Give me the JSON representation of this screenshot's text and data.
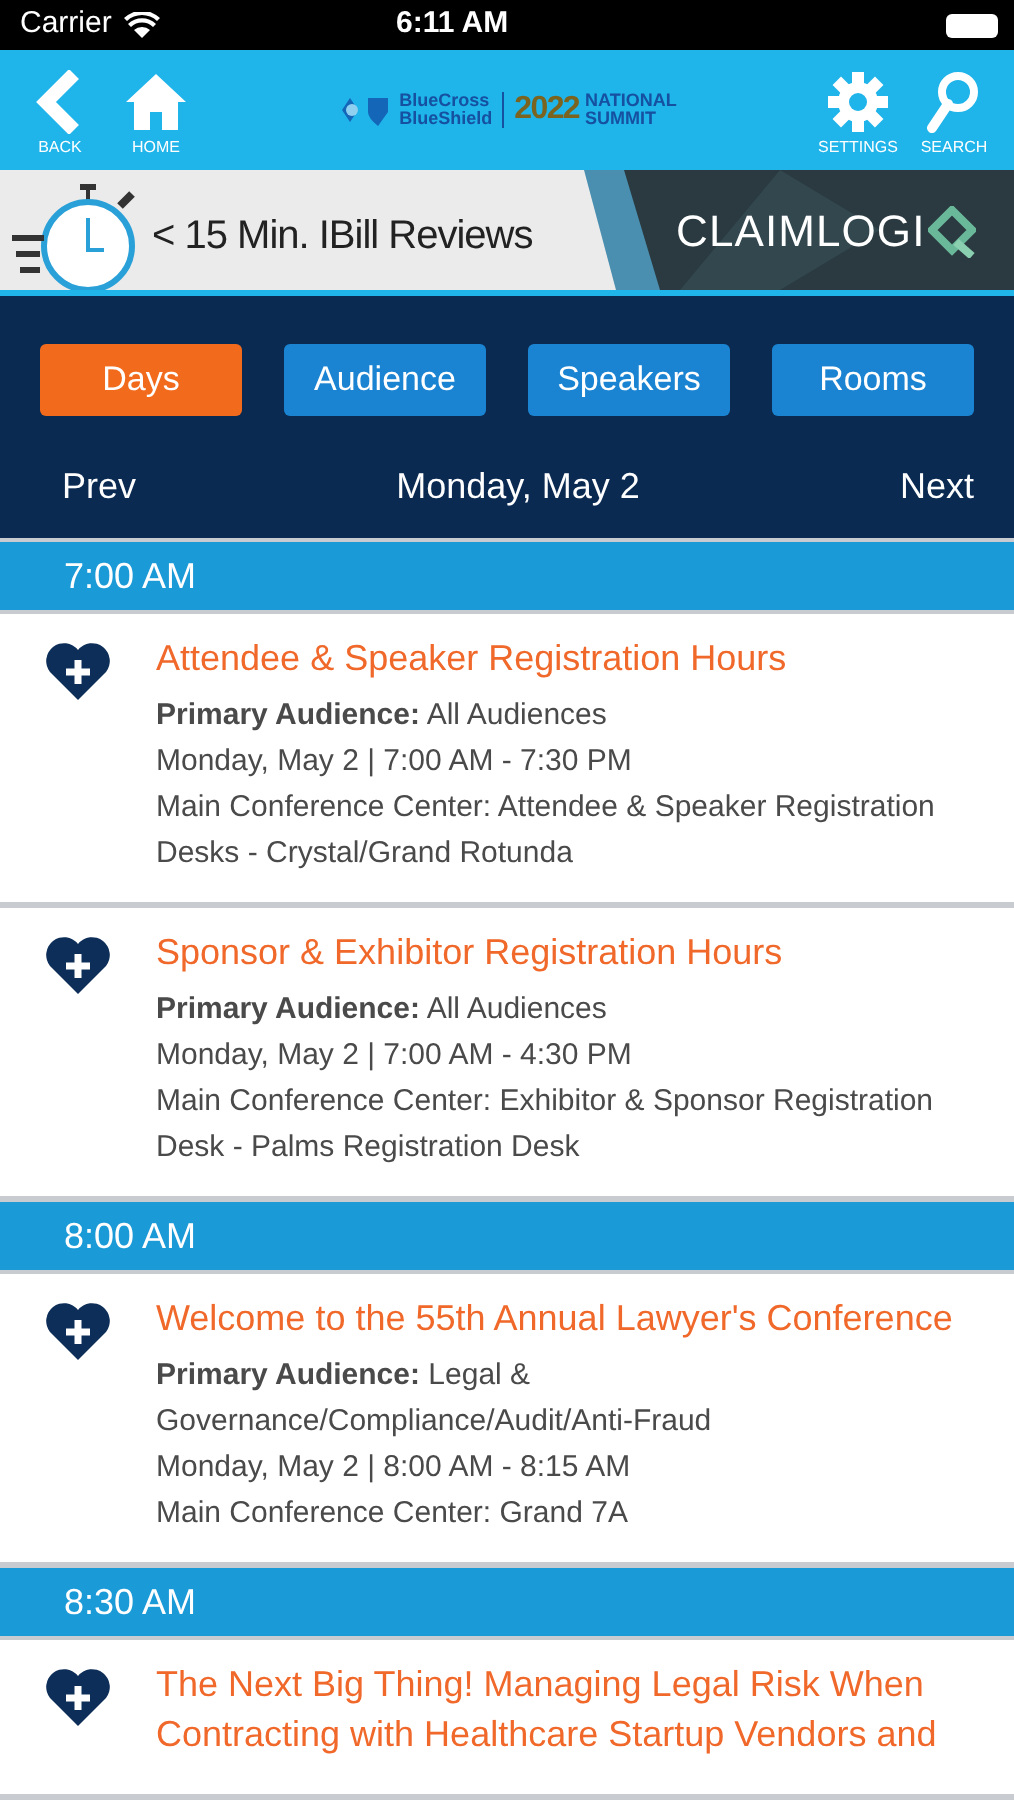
{
  "status_bar": {
    "carrier": "Carrier",
    "time": "6:11 AM"
  },
  "nav_bar": {
    "left": [
      {
        "kind": "back",
        "label": "BACK"
      },
      {
        "kind": "home",
        "label": "HOME"
      }
    ],
    "logo": {
      "brand_line_1": "BlueCross",
      "brand_line_2": "BlueShield",
      "year": "2022",
      "event_line_1": "NATIONAL",
      "event_line_2": "SUMMIT"
    },
    "right": [
      {
        "kind": "settings",
        "label": "SETTINGS"
      },
      {
        "kind": "search",
        "label": "SEARCH"
      }
    ]
  },
  "banner": {
    "headline": "< 15 Min. IBill Reviews",
    "brand": "CLAIMLOGI"
  },
  "tabs": [
    {
      "label": "Days",
      "selected": true
    },
    {
      "label": "Audience",
      "selected": false
    },
    {
      "label": "Speakers",
      "selected": false
    },
    {
      "label": "Rooms",
      "selected": false
    }
  ],
  "day_nav": {
    "prev": "Prev",
    "day": "Monday, May 2",
    "next": "Next"
  },
  "schedule": [
    {
      "time": "7:00 AM",
      "sessions": [
        {
          "title": "Attendee & Speaker Registration Hours",
          "audience": "**Primary Audience:** All Audiences",
          "when": "Monday, May 2 | 7:00 AM - 7:30 PM",
          "where": "Main Conference Center: Attendee & Speaker Registration Desks - Crystal/Grand Rotunda"
        },
        {
          "title": "Sponsor & Exhibitor Registration Hours",
          "audience": "**Primary Audience:** All Audiences",
          "when": "Monday, May 2 | 7:00 AM - 4:30 PM",
          "where": "Main Conference Center: Exhibitor & Sponsor Registration Desk - Palms Registration Desk"
        }
      ]
    },
    {
      "time": "8:00 AM",
      "sessions": [
        {
          "title": "Welcome to the 55th Annual Lawyer's Conference",
          "audience": "**Primary Audience:** Legal & Governance/Compliance/Audit/Anti-Fraud",
          "when": "Monday, May 2 | 8:00 AM - 8:15 AM",
          "where": "Main Conference Center: Grand 7A"
        }
      ]
    },
    {
      "time": "8:30 AM",
      "sessions": [
        {
          "title": "The Next Big Thing! Managing Legal Risk When Contracting with Healthcare Startup Vendors and"
        }
      ]
    }
  ]
}
